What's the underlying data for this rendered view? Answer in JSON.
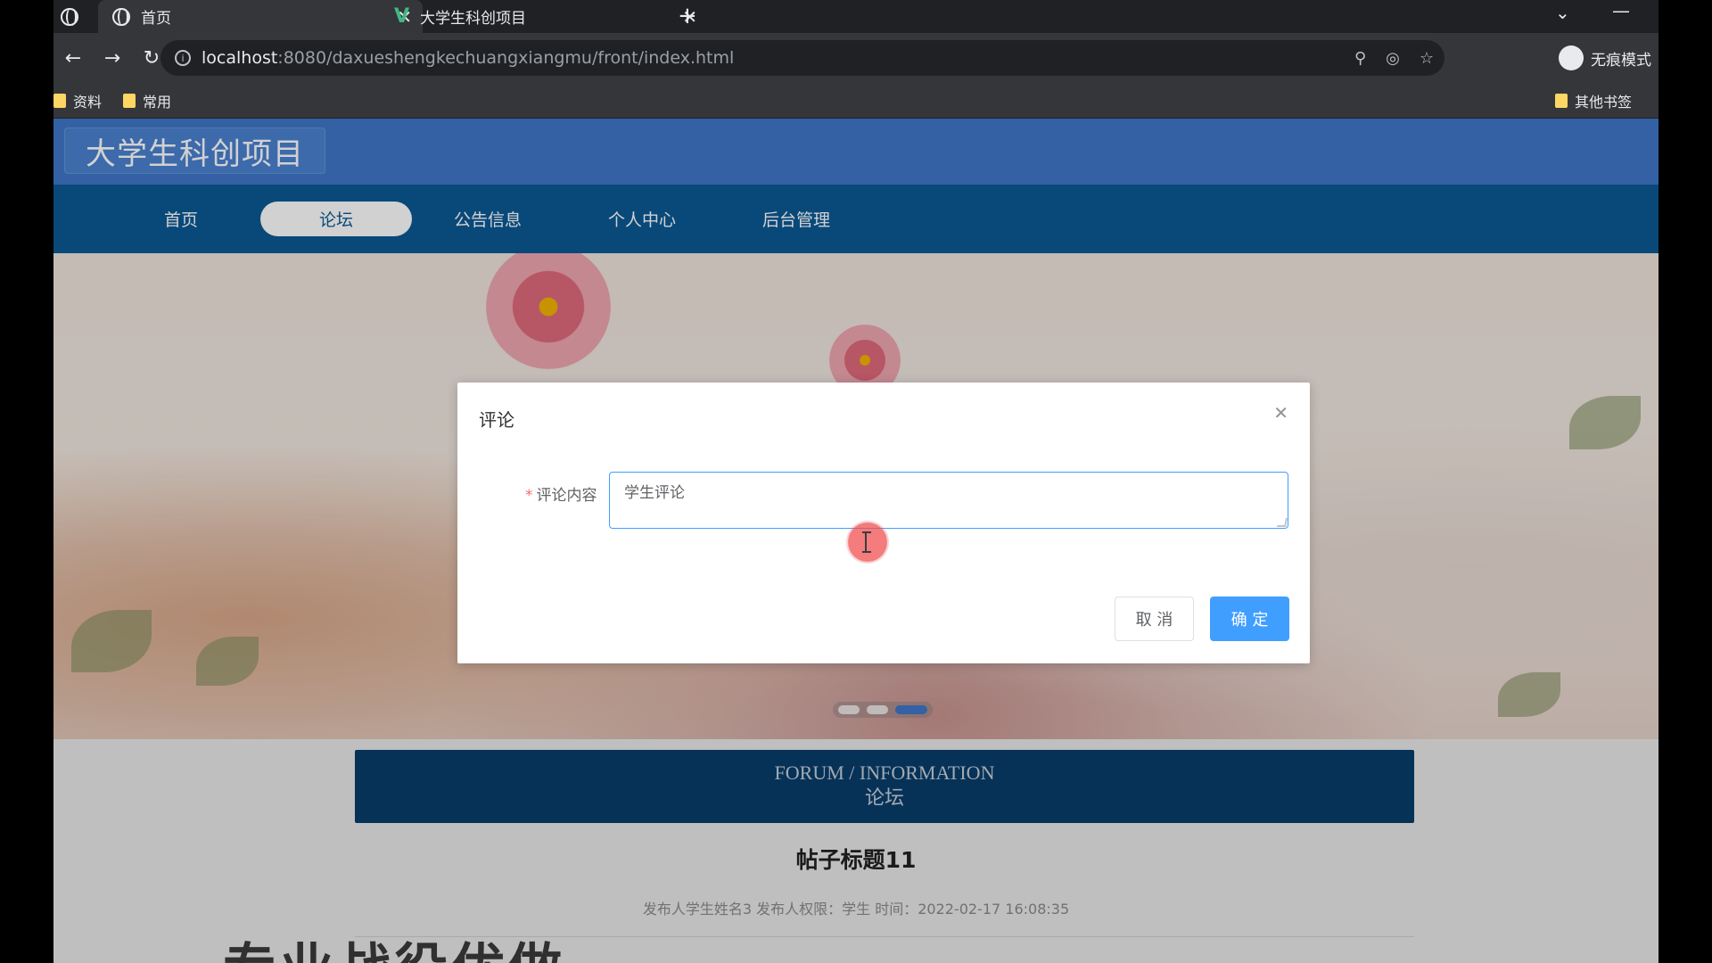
{
  "browser": {
    "tabs": [
      {
        "title": "首页",
        "active": true
      },
      {
        "title": "大学生科创项目",
        "active": false
      }
    ],
    "address": {
      "host": "localhost",
      "path": ":8080/daxueshengkechuangxiangmu/front/index.html"
    },
    "incognito_label": "无痕模式",
    "bookmarks": [
      "资料",
      "常用"
    ],
    "other_bookmarks": "其他书签"
  },
  "site": {
    "title": "大学生科创项目",
    "nav": [
      "首页",
      "论坛",
      "公告信息",
      "个人中心",
      "后台管理"
    ],
    "active_nav_index": 1
  },
  "forum": {
    "bar_en": "FORUM / INFORMATION",
    "bar_cn": "论坛",
    "post_title": "帖子标题11",
    "post_meta": "发布人学生姓名3   发布人权限：学生   时间：2022-02-17 16:08:35",
    "big_text": "专业战役优做"
  },
  "dialog": {
    "title": "评论",
    "label": "评论内容",
    "value": "学生评论",
    "cancel": "取 消",
    "confirm": "确 定"
  },
  "colors": {
    "header": "#3f77c8",
    "nav": "#0c5a95",
    "forum_bar": "#083d6c",
    "primary": "#409eff"
  }
}
